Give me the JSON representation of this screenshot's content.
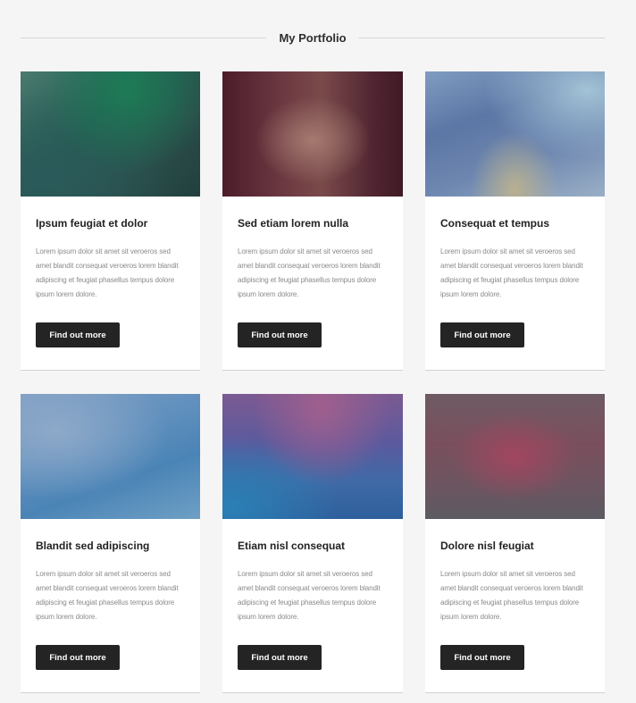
{
  "section": {
    "title": "My Portfolio"
  },
  "cards": [
    {
      "title": "Ipsum feugiat et dolor",
      "text": "Lorem ipsum dolor sit amet sit veroeros sed amet blandit consequat veroeros lorem blandit adipiscing et feugiat phasellus tempus dolore ipsum lorem dolore.",
      "button": "Find out more"
    },
    {
      "title": "Sed etiam lorem nulla",
      "text": "Lorem ipsum dolor sit amet sit veroeros sed amet blandit consequat veroeros lorem blandit adipiscing et feugiat phasellus tempus dolore ipsum lorem dolore.",
      "button": "Find out more"
    },
    {
      "title": "Consequat et tempus",
      "text": "Lorem ipsum dolor sit amet sit veroeros sed amet blandit consequat veroeros lorem blandit adipiscing et feugiat phasellus tempus dolore ipsum lorem dolore.",
      "button": "Find out more"
    },
    {
      "title": "Blandit sed adipiscing",
      "text": "Lorem ipsum dolor sit amet sit veroeros sed amet blandit consequat veroeros lorem blandit adipiscing et feugiat phasellus tempus dolore ipsum lorem dolore.",
      "button": "Find out more"
    },
    {
      "title": "Etiam nisl consequat",
      "text": "Lorem ipsum dolor sit amet sit veroeros sed amet blandit consequat veroeros lorem blandit adipiscing et feugiat phasellus tempus dolore ipsum lorem dolore.",
      "button": "Find out more"
    },
    {
      "title": "Dolore nisl feugiat",
      "text": "Lorem ipsum dolor sit amet sit veroeros sed amet blandit consequat veroeros lorem blandit adipiscing et feugiat phasellus tempus dolore ipsum lorem dolore.",
      "button": "Find out more"
    }
  ],
  "colors": {
    "page_background": "#f5f5f5",
    "card_background": "#ffffff",
    "button_background": "#242424",
    "button_text": "#ffffff"
  }
}
